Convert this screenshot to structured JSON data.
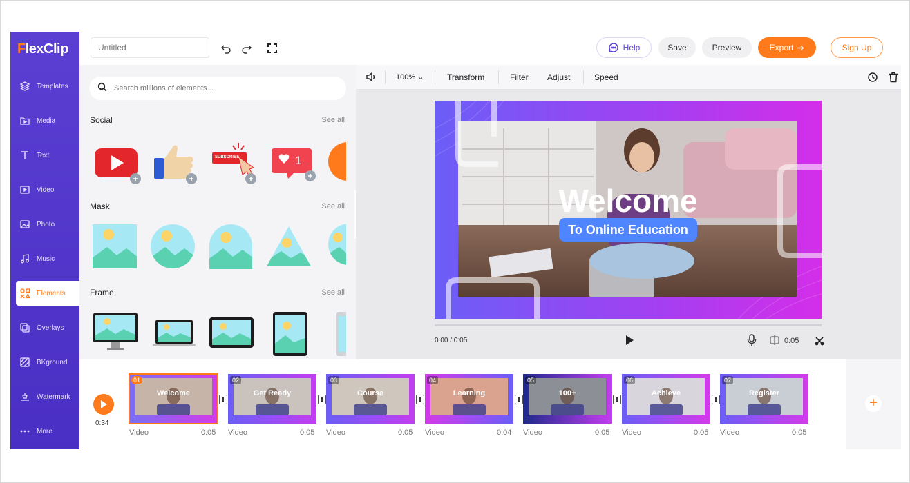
{
  "app": {
    "logo_prefix": "F",
    "logo_rest": "lexClip"
  },
  "colors": {
    "brand_purple": "#5b3fd3",
    "accent_orange": "#ff7a1a"
  },
  "sidebar": {
    "items": [
      {
        "label": "Templates",
        "icon": "layers-icon"
      },
      {
        "label": "Media",
        "icon": "folder-icon"
      },
      {
        "label": "Text",
        "icon": "text-icon"
      },
      {
        "label": "Video",
        "icon": "video-icon"
      },
      {
        "label": "Photo",
        "icon": "photo-icon"
      },
      {
        "label": "Music",
        "icon": "music-icon"
      },
      {
        "label": "Elements",
        "icon": "elements-icon",
        "active": true
      },
      {
        "label": "Overlays",
        "icon": "overlays-icon"
      },
      {
        "label": "BKground",
        "icon": "background-icon"
      },
      {
        "label": "Watermark",
        "icon": "watermark-icon"
      },
      {
        "label": "More",
        "icon": "more-icon"
      }
    ]
  },
  "topbar": {
    "title_placeholder": "Untitled",
    "help": "Help",
    "save": "Save",
    "preview": "Preview",
    "export": "Export",
    "signup": "Sign Up"
  },
  "panel": {
    "search_placeholder": "Search millions of elements...",
    "sections": [
      {
        "title": "Social",
        "see_all": "See all"
      },
      {
        "title": "Mask",
        "see_all": "See all"
      },
      {
        "title": "Frame",
        "see_all": "See all"
      }
    ],
    "subscribe_text": "SUBSCRIBE",
    "like_count": "1"
  },
  "editor": {
    "zoom": "100%",
    "tools": [
      "Transform",
      "Filter",
      "Adjust",
      "Speed"
    ],
    "time_current": "0:00 / 0:05",
    "clip_duration": "0:05",
    "canvas_title": "Welcome",
    "canvas_subtitle": "To Online Education"
  },
  "timeline": {
    "total_duration": "0:34",
    "clips": [
      {
        "num": "01",
        "label": "Video",
        "duration": "0:05",
        "text": "Welcome"
      },
      {
        "num": "02",
        "label": "Video",
        "duration": "0:05",
        "text": "Get Ready"
      },
      {
        "num": "03",
        "label": "Video",
        "duration": "0:05",
        "text": "Course"
      },
      {
        "num": "04",
        "label": "Video",
        "duration": "0:04",
        "text": "Learning"
      },
      {
        "num": "05",
        "label": "Video",
        "duration": "0:05",
        "text": "100+"
      },
      {
        "num": "06",
        "label": "Video",
        "duration": "0:05",
        "text": "Achieve"
      },
      {
        "num": "07",
        "label": "Video",
        "duration": "0:05",
        "text": "Register"
      }
    ]
  }
}
